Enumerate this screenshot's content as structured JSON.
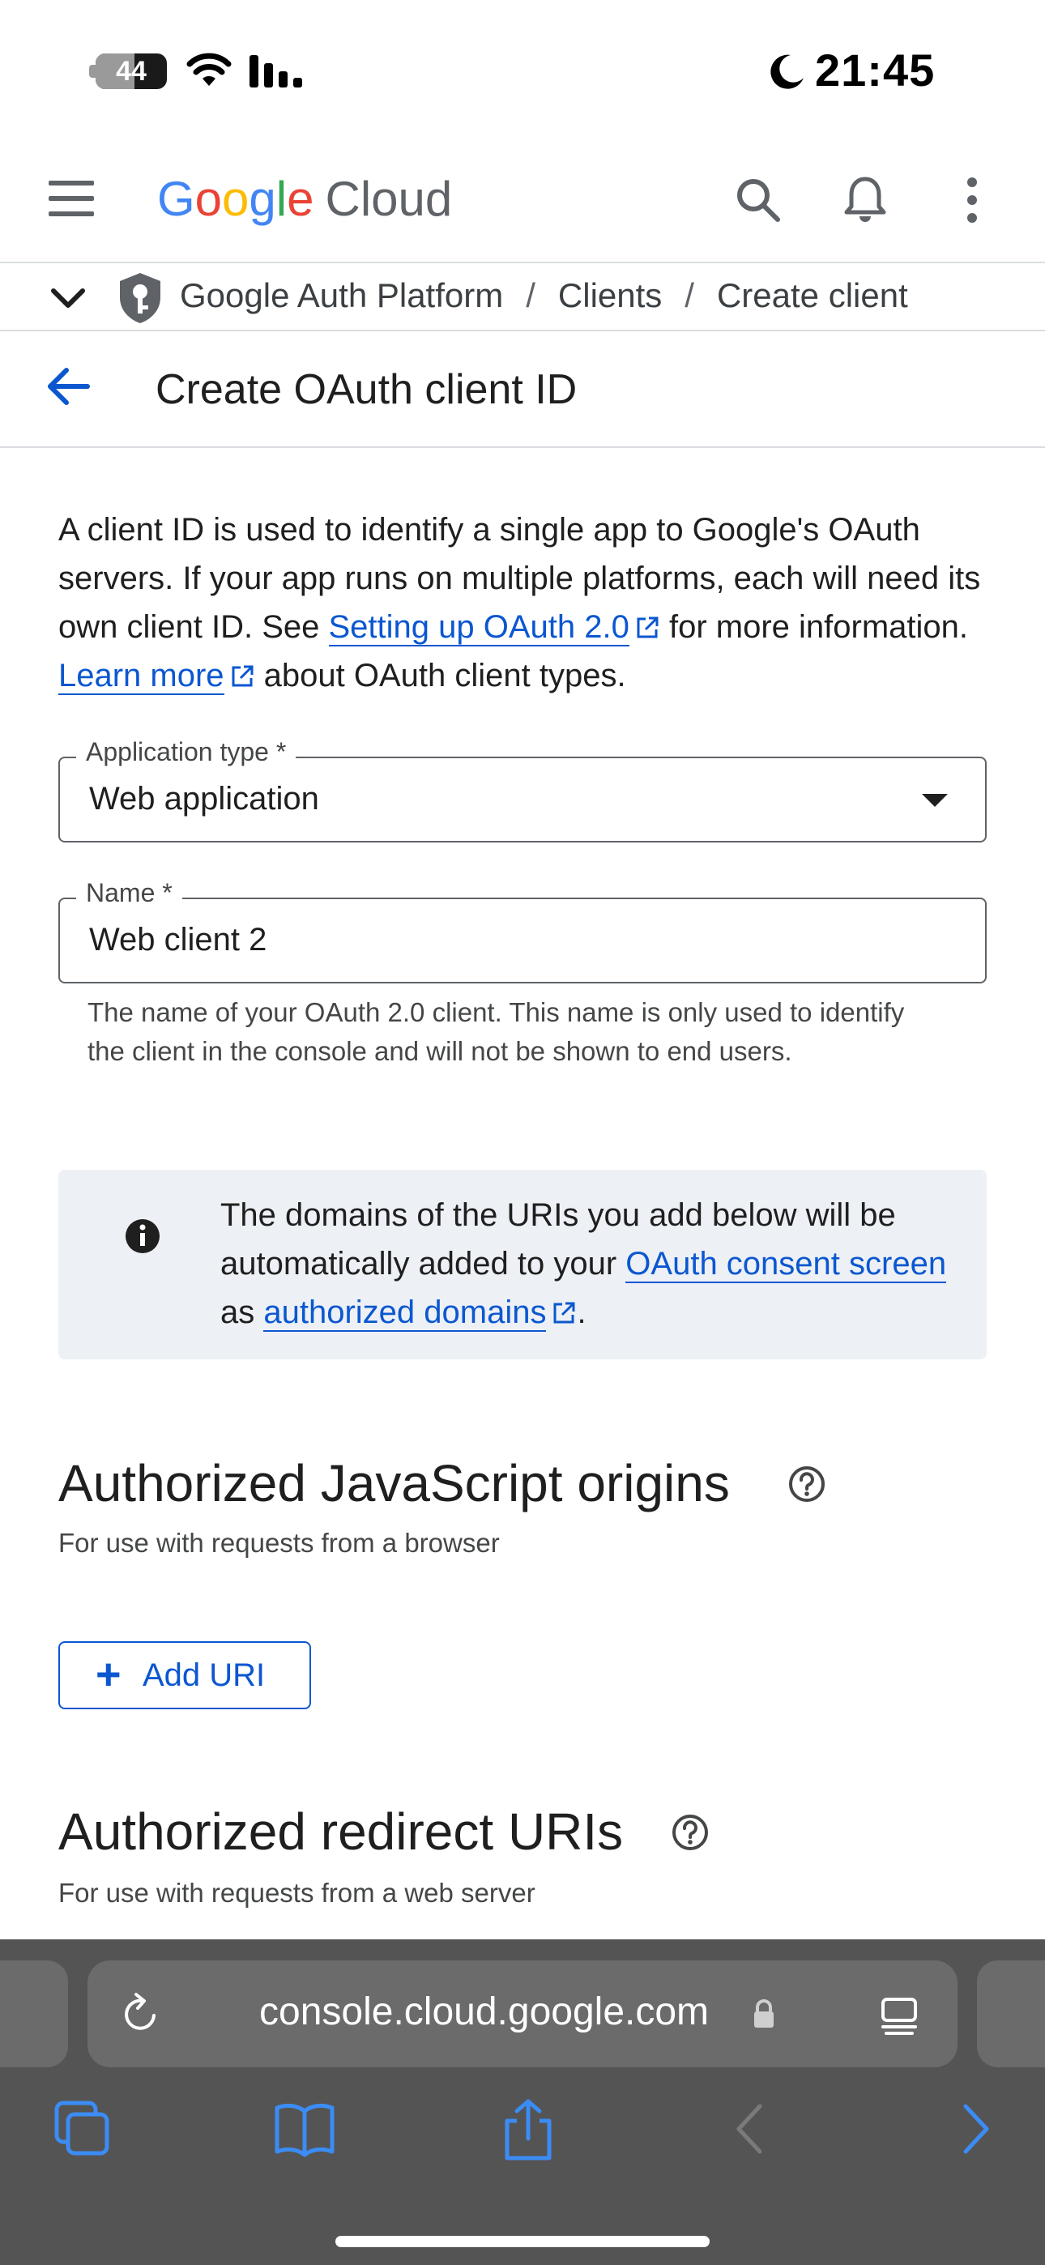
{
  "status_bar": {
    "battery": "44",
    "time": "21:45"
  },
  "header": {
    "logo_google": "Google",
    "logo_cloud": "Cloud"
  },
  "breadcrumb": {
    "items": [
      "Google Auth Platform",
      "Clients",
      "Create client"
    ],
    "separator": "/"
  },
  "page": {
    "title": "Create OAuth client ID"
  },
  "intro": {
    "text1": "A client ID is used to identify a single app to Google's OAuth servers. If your app runs on multiple platforms, each will need its own client ID. See ",
    "link1": "Setting up OAuth 2.0",
    "text2": " for more information. ",
    "link2": "Learn more",
    "text3": " about OAuth client types."
  },
  "application_type": {
    "label": "Application type *",
    "value": "Web application"
  },
  "name_field": {
    "label": "Name *",
    "value": "Web client 2",
    "helper": "The name of your OAuth 2.0 client. This name is only used to identify the client in the console and will not be shown to end users."
  },
  "notice": {
    "text1": "The domains of the URIs you add below will be automatically added to your ",
    "link1": "OAuth consent screen",
    "text2": " as ",
    "link2": "authorized domains",
    "text3": "."
  },
  "js_origins": {
    "title": "Authorized JavaScript origins",
    "subtitle": "For use with requests from a browser",
    "add_button": "Add URI"
  },
  "redirect_uris": {
    "title": "Authorized redirect URIs",
    "subtitle": "For use with requests from a web server"
  },
  "browser": {
    "url": "console.cloud.google.com"
  },
  "colors": {
    "link": "#0b57d0",
    "notice_bg": "#edf0f5",
    "browser_bar": "#545454"
  }
}
